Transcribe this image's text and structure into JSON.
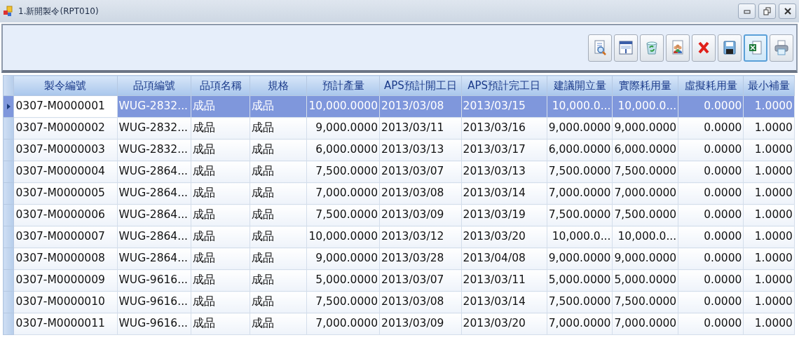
{
  "window": {
    "title": "1.新開製令(RPT010)"
  },
  "toolbar": [
    {
      "kind": "preview",
      "selected": false
    },
    {
      "kind": "form",
      "selected": false
    },
    {
      "kind": "recycle",
      "selected": false
    },
    {
      "kind": "people",
      "selected": false
    },
    {
      "kind": "delete",
      "selected": false
    },
    {
      "kind": "save",
      "selected": false
    },
    {
      "kind": "excel",
      "selected": true
    },
    {
      "kind": "print",
      "selected": false
    }
  ],
  "table": {
    "columns": [
      {
        "label": "製令編號",
        "kind": "text"
      },
      {
        "label": "品項編號",
        "kind": "text"
      },
      {
        "label": "品項名稱",
        "kind": "text"
      },
      {
        "label": "規格",
        "kind": "text"
      },
      {
        "label": "預計產量",
        "kind": "number"
      },
      {
        "label": "APS預計開工日",
        "kind": "text"
      },
      {
        "label": "APS預計完工日",
        "kind": "text"
      },
      {
        "label": "建議開立量",
        "kind": "number"
      },
      {
        "label": "實際耗用量",
        "kind": "number"
      },
      {
        "label": "虛擬耗用量",
        "kind": "number"
      },
      {
        "label": "最小補量",
        "kind": "number"
      }
    ],
    "rows": [
      {
        "selected": true,
        "cells": [
          "0307-M0000001",
          "WUG-2832...",
          "成品",
          "成品",
          "10,000.0000",
          "2013/03/08",
          "2013/03/15",
          "10,000.0...",
          "10,000.0...",
          "0.0000",
          "1.0000"
        ]
      },
      {
        "selected": false,
        "cells": [
          "0307-M0000002",
          "WUG-2832...",
          "成品",
          "成品",
          "9,000.0000",
          "2013/03/11",
          "2013/03/16",
          "9,000.0000",
          "9,000.0000",
          "0.0000",
          "1.0000"
        ]
      },
      {
        "selected": false,
        "cells": [
          "0307-M0000003",
          "WUG-2832...",
          "成品",
          "成品",
          "6,000.0000",
          "2013/03/13",
          "2013/03/17",
          "6,000.0000",
          "6,000.0000",
          "0.0000",
          "1.0000"
        ]
      },
      {
        "selected": false,
        "cells": [
          "0307-M0000004",
          "WUG-2864...",
          "成品",
          "成品",
          "7,500.0000",
          "2013/03/07",
          "2013/03/13",
          "7,500.0000",
          "7,500.0000",
          "0.0000",
          "1.0000"
        ]
      },
      {
        "selected": false,
        "cells": [
          "0307-M0000005",
          "WUG-2864...",
          "成品",
          "成品",
          "7,000.0000",
          "2013/03/08",
          "2013/03/14",
          "7,000.0000",
          "7,000.0000",
          "0.0000",
          "1.0000"
        ]
      },
      {
        "selected": false,
        "cells": [
          "0307-M0000006",
          "WUG-2864...",
          "成品",
          "成品",
          "7,500.0000",
          "2013/03/09",
          "2013/03/19",
          "7,500.0000",
          "7,500.0000",
          "0.0000",
          "1.0000"
        ]
      },
      {
        "selected": false,
        "cells": [
          "0307-M0000007",
          "WUG-2864...",
          "成品",
          "成品",
          "10,000.0000",
          "2013/03/12",
          "2013/03/20",
          "10,000.0...",
          "10,000.0...",
          "0.0000",
          "1.0000"
        ]
      },
      {
        "selected": false,
        "cells": [
          "0307-M0000008",
          "WUG-2864...",
          "成品",
          "成品",
          "9,000.0000",
          "2013/03/28",
          "2013/04/08",
          "9,000.0000",
          "9,000.0000",
          "0.0000",
          "1.0000"
        ]
      },
      {
        "selected": false,
        "cells": [
          "0307-M0000009",
          "WUG-9616...",
          "成品",
          "成品",
          "5,000.0000",
          "2013/03/07",
          "2013/03/11",
          "5,000.0000",
          "5,000.0000",
          "0.0000",
          "1.0000"
        ]
      },
      {
        "selected": false,
        "cells": [
          "0307-M0000010",
          "WUG-9616...",
          "成品",
          "成品",
          "7,500.0000",
          "2013/03/08",
          "2013/03/14",
          "7,500.0000",
          "7,500.0000",
          "0.0000",
          "1.0000"
        ]
      },
      {
        "selected": false,
        "cells": [
          "0307-M0000011",
          "WUG-9616...",
          "成品",
          "成品",
          "7,000.0000",
          "2013/03/09",
          "2013/03/20",
          "7,000.0000",
          "7,000.0000",
          "0.0000",
          "1.0000"
        ]
      }
    ]
  }
}
